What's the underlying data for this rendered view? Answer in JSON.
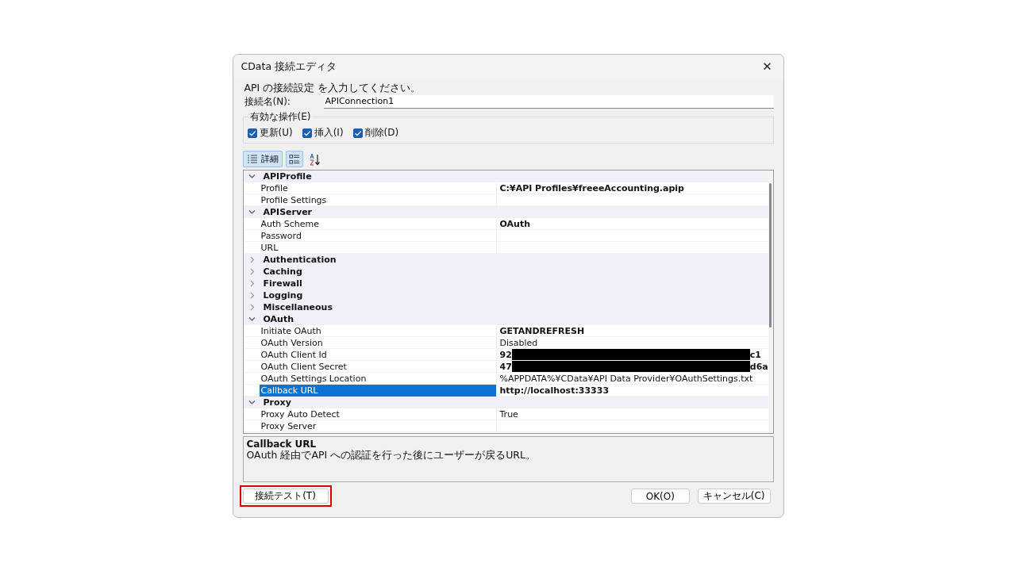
{
  "window": {
    "title": "CData 接続エディタ",
    "close": "✕"
  },
  "intro": "API の接続設定 を入力してください。",
  "connection_name": {
    "label": "接続名(N):",
    "value": "APIConnection1"
  },
  "operations": {
    "legend": "有効な操作(E)",
    "items": [
      {
        "label": "更新(U)",
        "checked": true
      },
      {
        "label": "挿入(I)",
        "checked": true
      },
      {
        "label": "削除(D)",
        "checked": true
      }
    ]
  },
  "toolbar": [
    {
      "kind": "details",
      "label": "詳細",
      "selected": true
    },
    {
      "kind": "categorized",
      "selected": true
    },
    {
      "kind": "alphabetical",
      "selected": false
    }
  ],
  "grid": [
    {
      "name": "APIProfile",
      "expanded": true,
      "children": [
        {
          "name": "Profile",
          "value": "C:¥API Profiles¥freeeAccounting.apip",
          "bold": true,
          "selected": false
        },
        {
          "name": "Profile Settings",
          "selected": false
        }
      ]
    },
    {
      "name": "APIServer",
      "expanded": true,
      "children": [
        {
          "name": "Auth Scheme",
          "value": "OAuth",
          "bold": true,
          "selected": false
        },
        {
          "name": "Password",
          "selected": false
        },
        {
          "name": "URL",
          "selected": false
        }
      ]
    },
    {
      "name": "Authentication",
      "expanded": false
    },
    {
      "name": "Caching",
      "expanded": false
    },
    {
      "name": "Firewall",
      "expanded": false
    },
    {
      "name": "Logging",
      "expanded": false
    },
    {
      "name": "Miscellaneous",
      "expanded": false
    },
    {
      "name": "OAuth",
      "expanded": true,
      "children": [
        {
          "name": "Initiate OAuth",
          "value": "GETANDREFRESH",
          "bold": true,
          "selected": false
        },
        {
          "name": "OAuth Version",
          "value": "Disabled",
          "bold": false,
          "selected": false
        },
        {
          "name": "OAuth Client Id",
          "value": "92",
          "value_end": "c1",
          "redacted": true,
          "bold": true,
          "selected": false
        },
        {
          "name": "OAuth Client Secret",
          "value": "47",
          "value_end": "d6a",
          "redacted": true,
          "bold": true,
          "selected": false
        },
        {
          "name": "OAuth Settings Location",
          "value": "%APPDATA%¥CData¥API Data Provider¥OAuthSettings.txt",
          "bold": false,
          "selected": false
        },
        {
          "name": "Callback URL",
          "value": "http://localhost:33333",
          "bold": true,
          "selected": true
        }
      ]
    },
    {
      "name": "Proxy",
      "expanded": true,
      "children": [
        {
          "name": "Proxy Auto Detect",
          "value": "True",
          "bold": false,
          "selected": false
        },
        {
          "name": "Proxy Server",
          "selected": false
        }
      ]
    }
  ],
  "description": {
    "title": "Callback URL",
    "text": "OAuth 経由でAPI への認証を行った後にユーザーが戻るURL。"
  },
  "buttons": [
    {
      "kind": "test",
      "label": "接続テスト(T)",
      "highlighted": true
    },
    {
      "kind": "ok",
      "label": "OK(O)",
      "highlighted": false
    },
    {
      "kind": "cancel",
      "label": "キャンセル(C)",
      "highlighted": false
    }
  ]
}
